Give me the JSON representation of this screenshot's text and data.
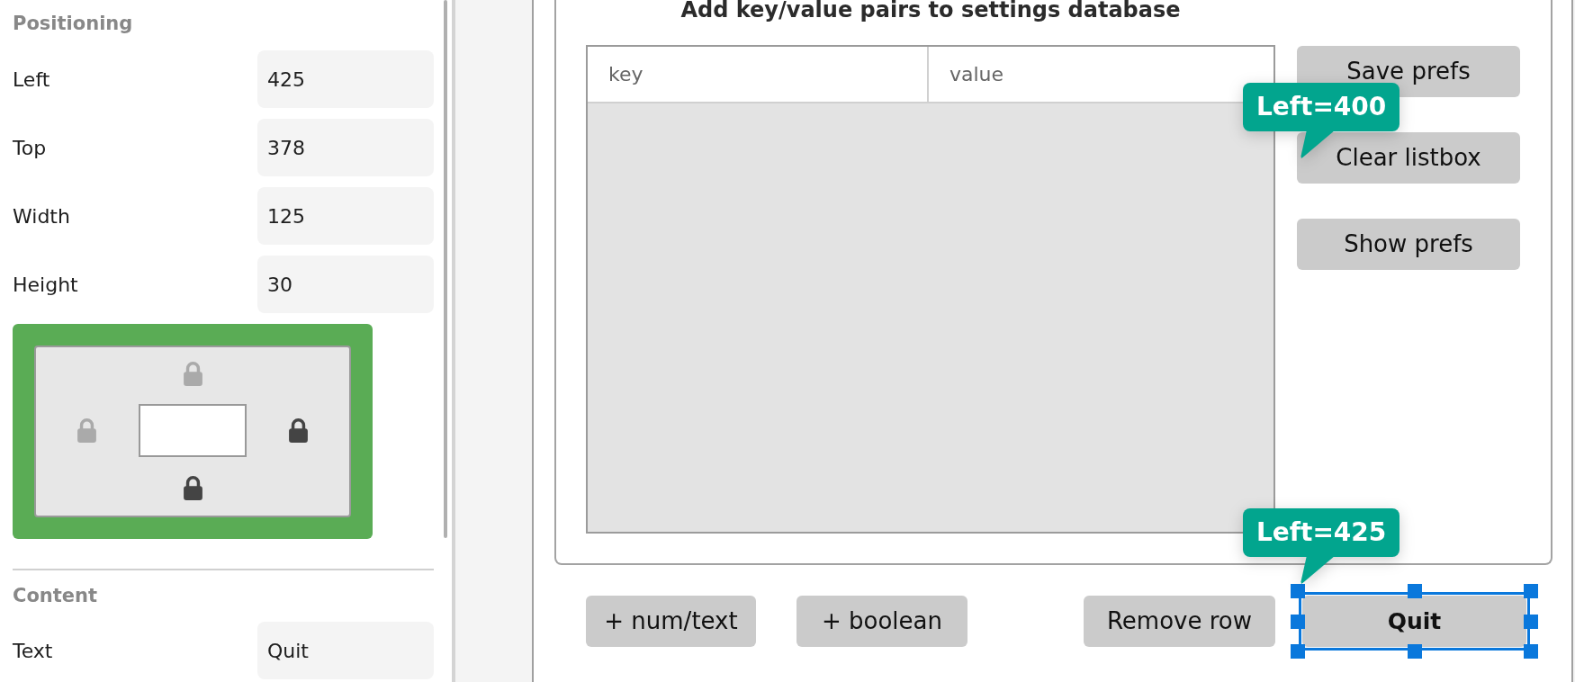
{
  "inspector": {
    "positioning": {
      "title": "Positioning",
      "fields": [
        {
          "label": "Left",
          "value": "425"
        },
        {
          "label": "Top",
          "value": "378"
        },
        {
          "label": "Width",
          "value": "125"
        },
        {
          "label": "Height",
          "value": "30"
        }
      ]
    },
    "anchors": {
      "top": {
        "locked": false
      },
      "left": {
        "locked": false
      },
      "right": {
        "locked": true
      },
      "bottom": {
        "locked": true
      }
    },
    "content": {
      "title": "Content",
      "fields": [
        {
          "label": "Text",
          "value": "Quit"
        }
      ]
    }
  },
  "form": {
    "heading": "Add key/value pairs to settings database",
    "listbox": {
      "columns": [
        "key",
        "value"
      ]
    },
    "side_buttons": [
      {
        "label": "Save prefs",
        "selected": false,
        "default": false
      },
      {
        "label": "Clear listbox",
        "selected": false,
        "default": false
      },
      {
        "label": "Show prefs",
        "selected": false,
        "default": false
      }
    ],
    "bottom_buttons": [
      {
        "label": "+ num/text",
        "selected": false,
        "default": false
      },
      {
        "label": "+ boolean",
        "selected": false,
        "default": false
      },
      {
        "label": "Remove row",
        "selected": false,
        "default": false
      },
      {
        "label": "Quit",
        "selected": true,
        "default": true
      }
    ],
    "tooltips": [
      "Left=400",
      "Left=425"
    ]
  }
}
